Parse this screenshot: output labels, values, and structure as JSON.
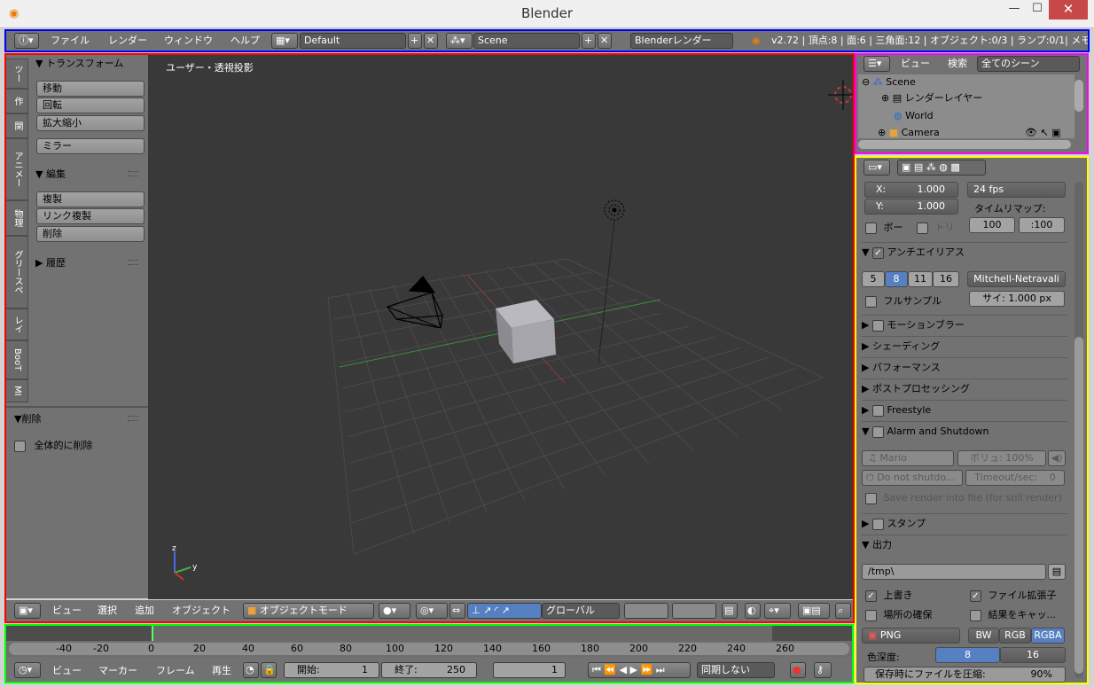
{
  "window": {
    "title": "Blender",
    "min": "—",
    "max": "☐",
    "close": "✕"
  },
  "topbar": {
    "menus": [
      "ファイル",
      "レンダー",
      "ウィンドウ",
      "ヘルプ"
    ],
    "layout": "Default",
    "scene": "Scene",
    "engine": "Blenderレンダー",
    "stats": "v2.72 | 頂点:8 | 面:6 | 三角面:12 | オブジェクト:0/3 | ランプ:0/1| メモ"
  },
  "toolshelf": {
    "tabs": [
      "ツー",
      "作",
      "関",
      "アニメー",
      "物理",
      "グリースペ",
      "レイ",
      "BooT",
      "MI"
    ],
    "transform_header": "▼ トランスフォーム",
    "transform_buttons": [
      "移動",
      "回転",
      "拡大縮小"
    ],
    "mirror": "ミラー",
    "edit_header": "▼ 編集",
    "edit_buttons": [
      "複製",
      "リンク複製",
      "削除"
    ],
    "history_header": "▶ 履歴",
    "op_header": "▼削除",
    "op_option": "全体的に削除"
  },
  "viewport": {
    "label": "ユーザー・透視投影",
    "axis_x": "y",
    "axis_z": "z"
  },
  "view_header": {
    "menus": [
      "ビュー",
      "選択",
      "追加",
      "オブジェクト"
    ],
    "mode": "オブジェクトモード",
    "orientation": "グローバル"
  },
  "outliner": {
    "menus": [
      "ビュー",
      "検索"
    ],
    "filter": "全てのシーン",
    "items": [
      "Scene",
      "レンダーレイヤー",
      "World",
      "Camera"
    ]
  },
  "properties": {
    "x_label": "X:",
    "x_val": "1.000",
    "y_label": "Y:",
    "y_val": "1.000",
    "fps": "24 fps",
    "timeremap": "タイムリマップ:",
    "bo": "ボー",
    "tori": "トリ",
    "remap_old": "100",
    "remap_new": ":100",
    "aa_header": "アンチエイリアス",
    "aa_samples": [
      "5",
      "8",
      "11",
      "16"
    ],
    "aa_filter": "Mitchell-Netravali",
    "fullsample": "フルサンプル",
    "size": "サイ: 1.000 px",
    "sections": [
      "モーションブラー",
      "シェーディング",
      "パフォーマンス",
      "ポストプロセッシング",
      "Freestyle",
      "Alarm and Shutdown"
    ],
    "mario": "Mario",
    "volume": "ボリュ: 100%",
    "donot": "Do not shutdo...",
    "timeout": "Timeout/sec:",
    "timeout_val": "0",
    "saverender": "Save render into file (for still render)",
    "stamp": "スタンプ",
    "output": "出力",
    "path": "/tmp\\",
    "overwrite": "上書き",
    "ext": "ファイル拡張子",
    "placeholder": "場所の確保",
    "cache": "結果をキャッ...",
    "format": "PNG",
    "bw": "BW",
    "rgb": "RGB",
    "rgba": "RGBA",
    "depth_label": "色深度:",
    "depth": [
      "8",
      "16"
    ],
    "compress": "保存時にファイルを圧縮:",
    "compress_val": "90%"
  },
  "timeline": {
    "ticks": [
      "-40",
      "-20",
      "0",
      "20",
      "40",
      "60",
      "80",
      "100",
      "120",
      "140",
      "160",
      "180",
      "200",
      "220",
      "240",
      "260"
    ],
    "menus": [
      "ビュー",
      "マーカー",
      "フレーム",
      "再生"
    ],
    "start": "開始:",
    "start_val": "1",
    "end": "終了:",
    "end_val": "250",
    "current": "1",
    "sync": "同期しない"
  },
  "colors": {
    "blue": "#0000ff",
    "red": "#ff0000",
    "magenta": "#ff00ff",
    "yellow": "#ffff00",
    "green": "#00ff00"
  }
}
